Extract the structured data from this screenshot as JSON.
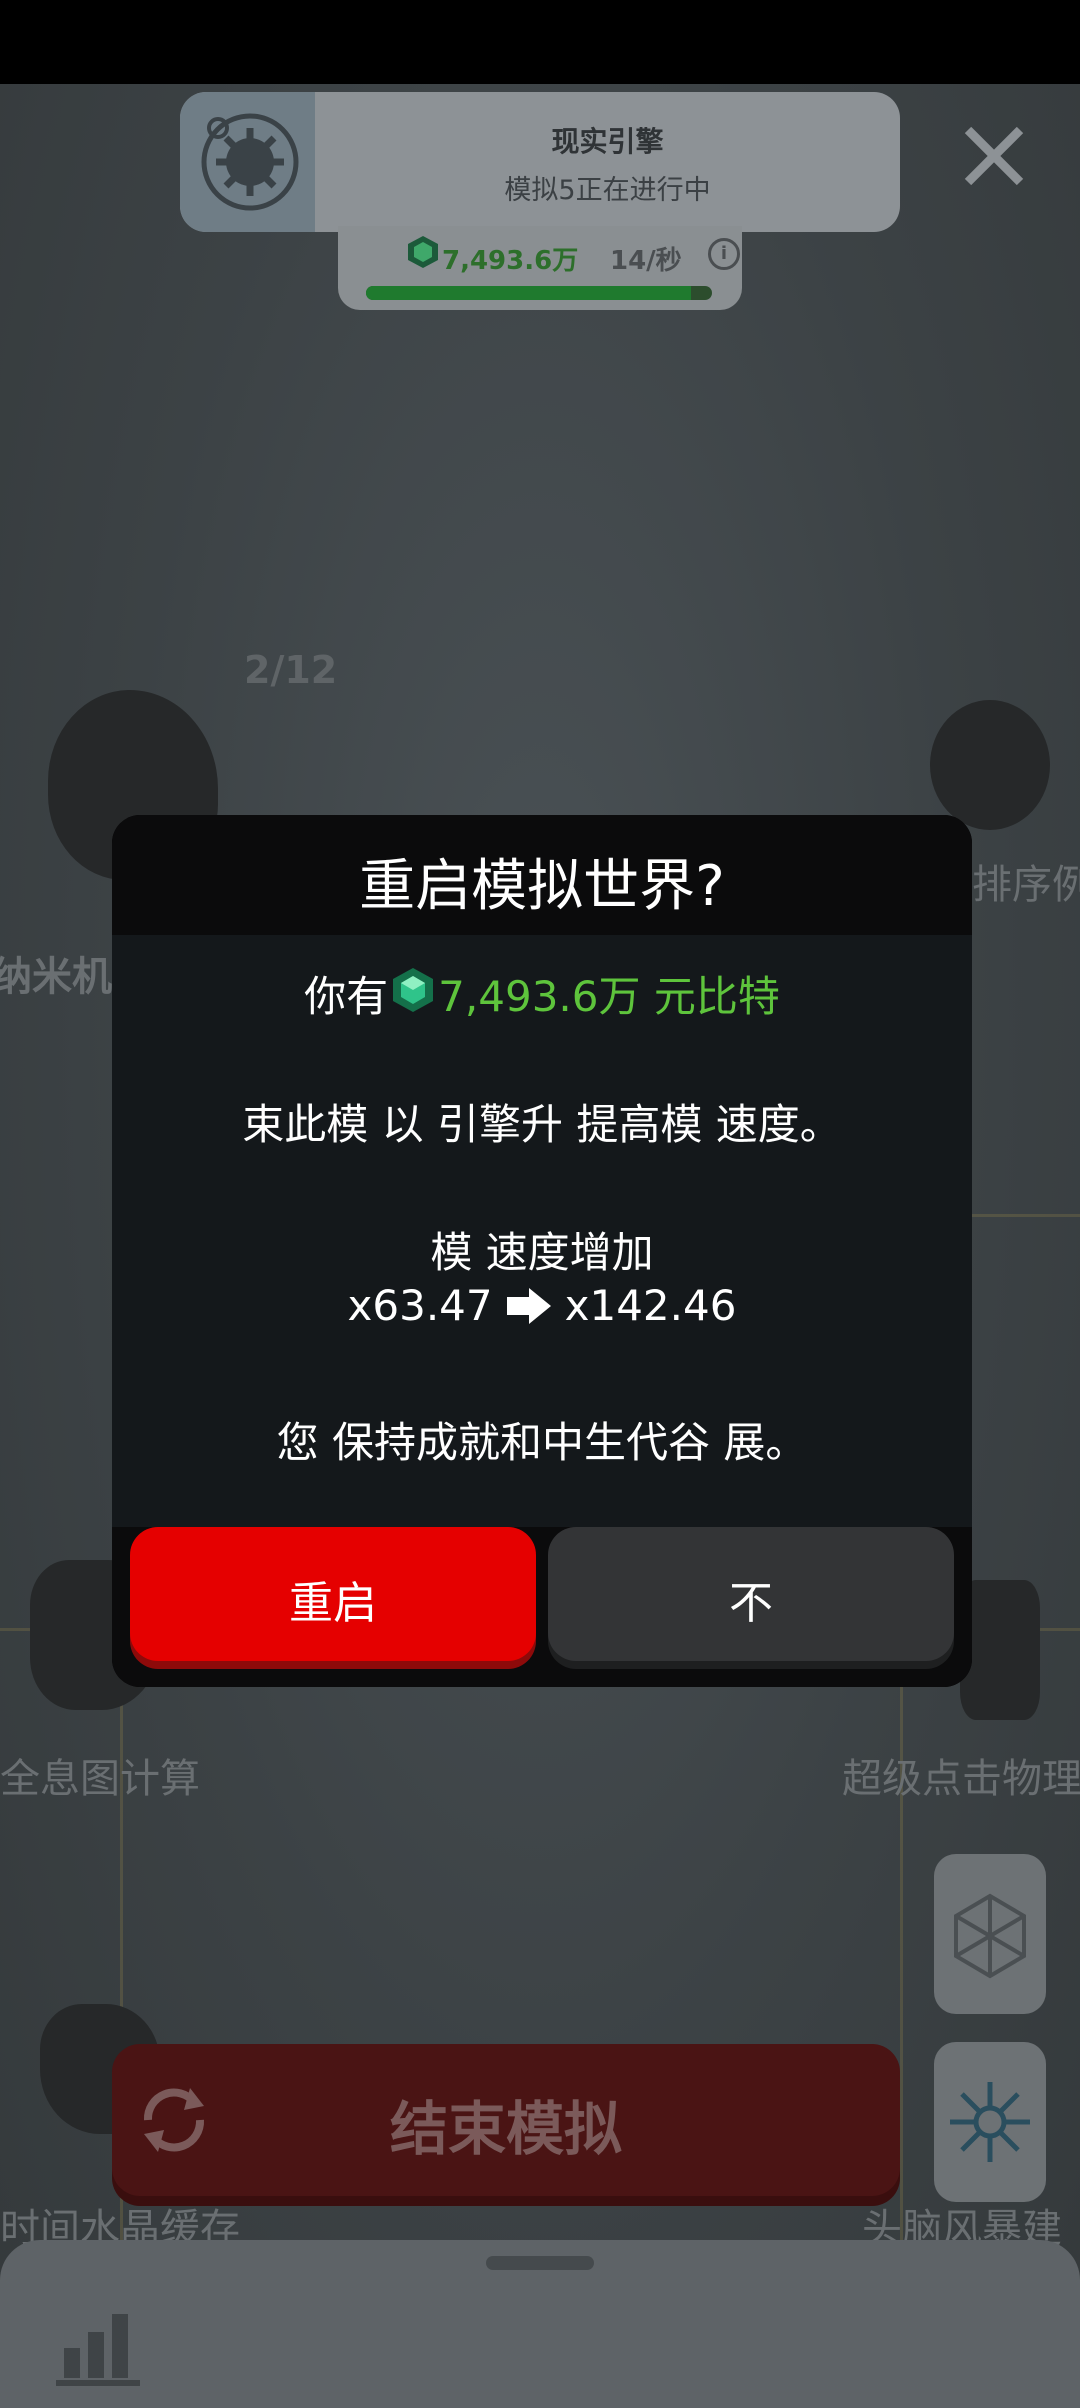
{
  "engine": {
    "title": "现实引擎",
    "subtitle": "模拟5正在进行中"
  },
  "resource_bar": {
    "amount": "7,493.6万",
    "rate": "14/秒",
    "info_icon": "info-icon",
    "progress": 0.94
  },
  "background": {
    "level_counter": "2/12",
    "node_labels": [
      "纳米机",
      "排序例",
      "全息图计算",
      "超级点击物理",
      "时间水晶缓存",
      "头脑风暴建"
    ]
  },
  "end_simulation": {
    "label": "结束模拟",
    "icon": "refresh-icon"
  },
  "side_buttons": [
    "network-icon",
    "neuron-icon"
  ],
  "bottom_sheet": {
    "icon": "bar-chart-icon"
  },
  "dialog": {
    "title": "重启模拟世界?",
    "have_prefix": "你有",
    "have_amount": "7,493.6万 元比特",
    "line1": "束此模 以   引擎升  提高模 速度。",
    "speed_label": "模 速度增加",
    "speed_from": "x63.47",
    "speed_to": "x142.46",
    "line3": "您 保持成就和中生代谷 展。",
    "restart_label": "重启",
    "no_label": "不"
  },
  "colors": {
    "restart_red": "#e50000",
    "gem_green": "#5ec43c"
  }
}
